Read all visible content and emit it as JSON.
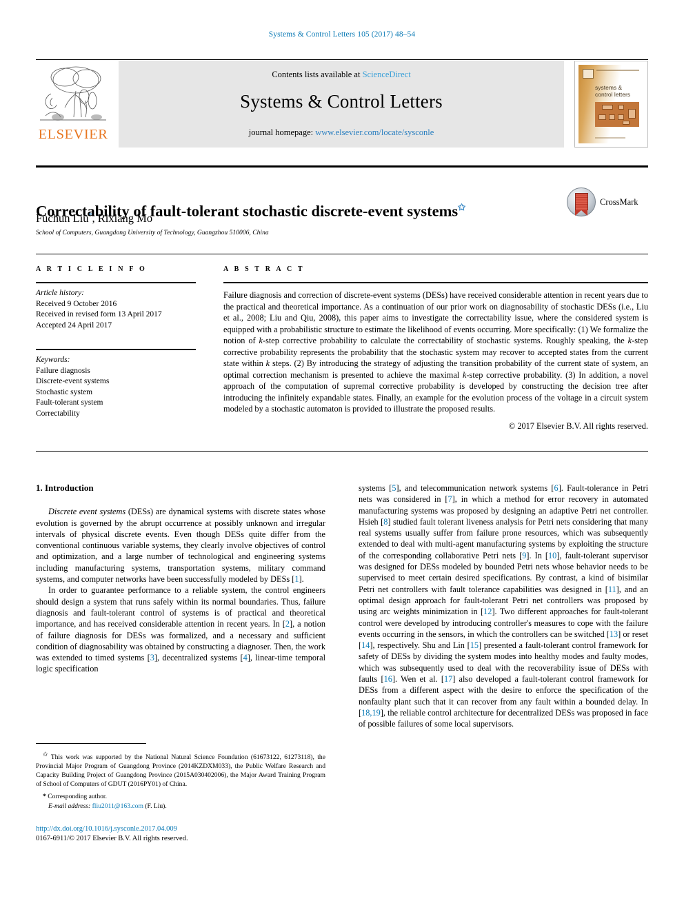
{
  "running_head": "Systems & Control Letters 105 (2017) 48–54",
  "masthead": {
    "contents_prefix": "Contents lists available at ",
    "sciencedirect": "ScienceDirect",
    "journal_name": "Systems & Control Letters",
    "homepage_prefix": "journal homepage: ",
    "homepage_url": "www.elsevier.com/locate/sysconle",
    "publisher": "ELSEVIER",
    "cover_title_line1": "systems &",
    "cover_title_line2": "control letters",
    "link_color": "#3aa0d8",
    "elsevier_orange": "#e87722"
  },
  "title": {
    "text": "Correctability of fault-tolerant stochastic discrete-event systems",
    "footnote_marker": "✩"
  },
  "authors": {
    "list": "Fuchun Liu",
    "corresponding_marker": "*",
    "second": ", Rixiang Mo",
    "affiliation": "School of Computers, Guangdong University of Technology, Guangzhou 510006, China"
  },
  "crossmark": {
    "label": "CrossMark"
  },
  "article_info": {
    "heading": "A R T I C L E   I N F O",
    "history_label": "Article history:",
    "history": [
      "Received 9 October 2016",
      "Received in revised form 13 April 2017",
      "Accepted 24 April 2017"
    ],
    "keywords_label": "Keywords:",
    "keywords": [
      "Failure diagnosis",
      "Discrete-event systems",
      "Stochastic system",
      "Fault-tolerant system",
      "Correctability"
    ]
  },
  "abstract": {
    "heading": "A B S T R A C T",
    "body_part1": "Failure diagnosis and correction of discrete-event systems (DESs) have received considerable attention in recent years due to the practical and theoretical importance. As a continuation of our prior work on diagnosability of stochastic DESs (i.e., Liu et al., 2008; Liu and Qiu, 2008), this paper aims to investigate the correctability issue, where the considered system is equipped with a probabilistic structure to estimate the likelihood of events occurring. More specifically: (1) We formalize the notion of ",
    "k1": "k",
    "body_part2": "-step corrective probability to calculate the correctability of stochastic systems. Roughly speaking, the ",
    "k2": "k",
    "body_part3": "-step corrective probability represents the probability that the stochastic system may recover to accepted states from the current state within ",
    "k3": "k",
    "body_part4": " steps. (2) By introducing the strategy of adjusting the transition probability of the current state of system, an optimal correction mechanism is presented to achieve the maximal ",
    "k4": "k",
    "body_part5": "-step corrective probability. (3) In addition, a novel approach of the computation of supremal corrective probability is developed by constructing the decision tree after introducing the infinitely expandable states. Finally, an example for the evolution process of the voltage in a circuit system modeled by a stochastic automaton is provided to illustrate the proposed results.",
    "copyright": "© 2017 Elsevier B.V. All rights reserved."
  },
  "introduction": {
    "heading": "1. Introduction",
    "p1_italic": "Discrete event systems",
    "p1_rest": " (DESs) are dynamical systems with discrete states whose evolution is governed by the abrupt occurrence at possibly unknown and irregular intervals of physical discrete events. Even though DESs quite differ from the conventional continuous variable systems, they clearly involve objectives of control and optimization, and a large number of technological and engineering systems including manufacturing systems, transportation systems, military command systems, and computer networks have been successfully modeled by DESs [",
    "p1_ref1": "1",
    "p1_tail": "].",
    "p2_a": "In order to guarantee performance to a reliable system, the control engineers should design a system that runs safely within its normal boundaries. Thus, failure diagnosis and fault-tolerant control of systems is of practical and theoretical importance, and has received considerable attention in recent years. In [",
    "p2_r2": "2",
    "p2_b": "], a notion of failure diagnosis for DESs was formalized, and a necessary and sufficient condition of diagnosability was obtained by constructing a diagnoser. Then, the work was extended to timed systems [",
    "p2_r3": "3",
    "p2_c": "], decentralized systems [",
    "p2_r4": "4",
    "p2_d": "], linear-time temporal logic specification",
    "r_a": "systems [",
    "r_5": "5",
    "r_b": "], and telecommunication network systems [",
    "r_6": "6",
    "r_c": "]. Fault-tolerance in Petri nets was considered in [",
    "r_7": "7",
    "r_d": "], in which a method for error recovery in automated manufacturing systems was proposed by designing an adaptive Petri net controller. Hsieh [",
    "r_8": "8",
    "r_e": "] studied fault tolerant liveness analysis for Petri nets considering that many real systems usually suffer from failure prone resources, which was subsequently extended to deal with multi-agent manufacturing systems by exploiting the structure of the corresponding collaborative Petri nets [",
    "r_9": "9",
    "r_f": "]. In [",
    "r_10": "10",
    "r_g": "], fault-tolerant supervisor was designed for DESs modeled by bounded Petri nets whose behavior needs to be supervised to meet certain desired specifications. By contrast, a kind of bisimilar Petri net controllers with fault tolerance capabilities was designed in [",
    "r_11": "11",
    "r_h": "], and an optimal design approach for fault-tolerant Petri net controllers was proposed by using arc weights minimization in [",
    "r_12": "12",
    "r_i": "]. Two different approaches for fault-tolerant control were developed by introducing controller's measures to cope with the failure events occurring in the sensors, in which the controllers can be switched [",
    "r_13": "13",
    "r_j": "] or reset [",
    "r_14": "14",
    "r_k": "], respectively. Shu and Lin [",
    "r_15": "15",
    "r_l": "] presented a fault-tolerant control framework for safety of DESs by dividing the system modes into healthy modes and faulty modes, which was subsequently used to deal with the recoverability issue of DESs with faults [",
    "r_16": "16",
    "r_m": "]. Wen et al. [",
    "r_17": "17",
    "r_n": "] also developed a fault-tolerant control framework for DESs from a different aspect with the desire to enforce the specification of the nonfaulty plant such that it can recover from any fault within a bounded delay. In [",
    "r_18": "18",
    "r_comma": ",",
    "r_19": "19",
    "r_o": "], the reliable control architecture for decentralized DESs was proposed in face of possible failures of some local supervisors."
  },
  "footnotes": {
    "funding_marker": "✩",
    "funding": " This work was supported by the National Natural Science Foundation (61673122, 61273118), the Provincial Major Program of Guangdong Province (2014KZDXM033), the Public Welfare Research and Capacity Building Project of Guangdong Province (2015A030402006), the Major Award Training Program of School of Computers of GDUT (2016PY01) of China.",
    "corresponding_marker": "*",
    "corresponding": " Corresponding author.",
    "email_label": "E-mail address:",
    "email": "fliu2011@163.com",
    "email_suffix": " (F. Liu)."
  },
  "bottom": {
    "doi": "http://dx.doi.org/10.1016/j.sysconle.2017.04.009",
    "issn_line": "0167-6911/© 2017 Elsevier B.V. All rights reserved."
  }
}
